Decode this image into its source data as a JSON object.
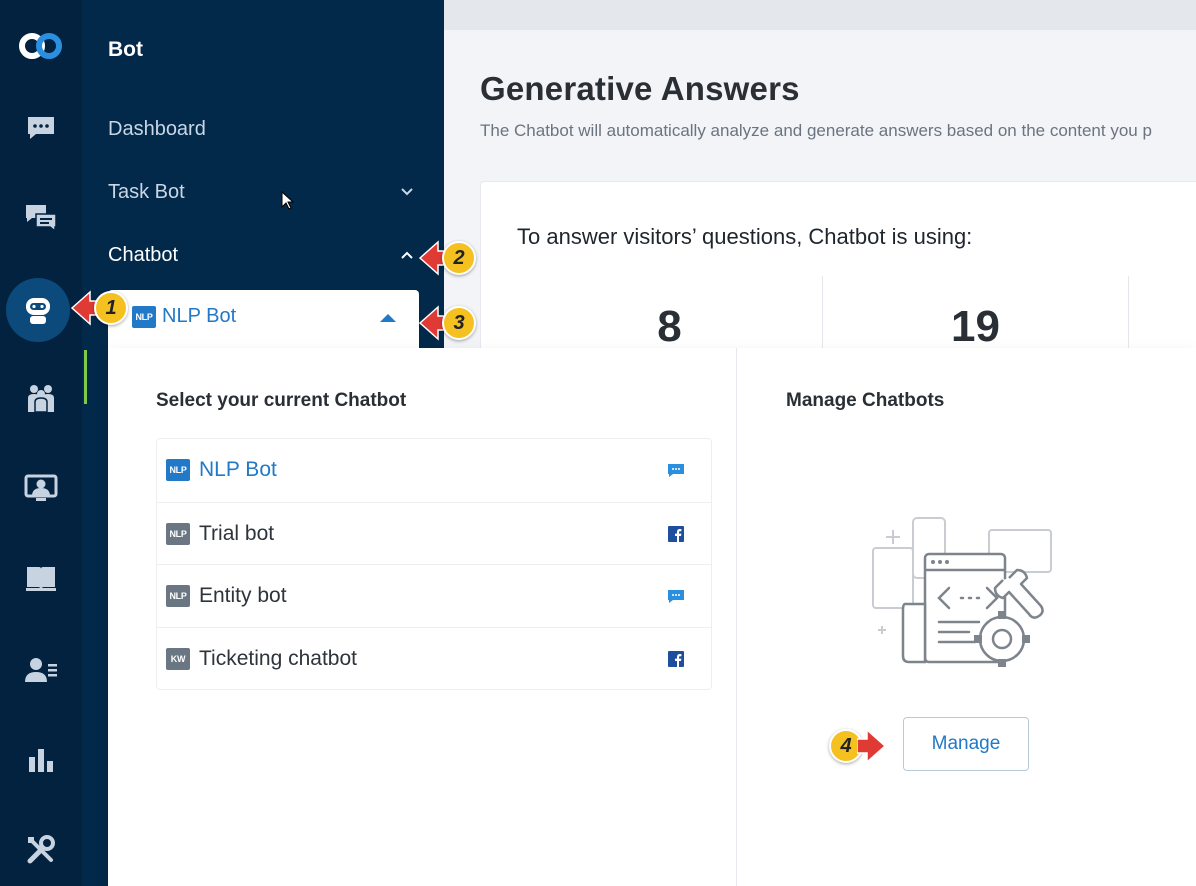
{
  "sidebar": {
    "title": "Bot",
    "items": [
      {
        "label": "Dashboard"
      },
      {
        "label": "Task Bot"
      },
      {
        "label": "Chatbot"
      }
    ]
  },
  "main": {
    "title": "Generative Answers",
    "subtitle": "The Chatbot will automatically analyze and generate answers based on the content you p",
    "stats_title": "To answer visitors’ questions, Chatbot is using:",
    "stats": [
      {
        "value": "8"
      },
      {
        "value": "19"
      }
    ]
  },
  "dropdown": {
    "current": "NLP Bot",
    "current_badge": "NLP",
    "select_heading": "Select your current Chatbot",
    "bots": [
      {
        "badge": "NLP",
        "name": "NLP Bot",
        "channel": "chat-icon",
        "selected": true
      },
      {
        "badge": "NLP",
        "name": "Trial bot",
        "channel": "facebook-icon",
        "selected": false
      },
      {
        "badge": "NLP",
        "name": "Entity bot",
        "channel": "chat-icon",
        "selected": false
      },
      {
        "badge": "KW",
        "name": "Ticketing chatbot",
        "channel": "facebook-icon",
        "selected": false
      }
    ],
    "manage_heading": "Manage Chatbots",
    "manage_button": "Manage"
  },
  "callouts": [
    "1",
    "2",
    "3",
    "4"
  ],
  "colors": {
    "rail": "#03223f",
    "sidebar": "#02284a",
    "accent": "#2179c8",
    "callout": "#f5c121",
    "arrow": "#e03a35"
  }
}
